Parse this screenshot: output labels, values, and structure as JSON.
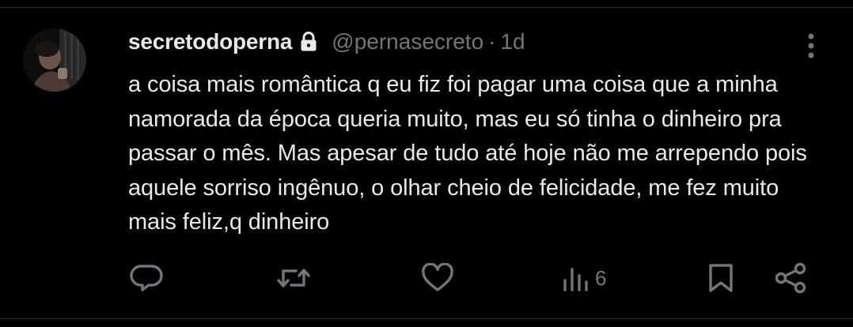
{
  "tweet": {
    "display_name": "secretodoperna",
    "handle": "@pernasecreto",
    "separator": "·",
    "time": "1d",
    "text": "a coisa mais romântica q eu fiz foi pagar uma coisa que a minha namorada da época queria muito, mas eu só tinha o dinheiro pra passar o mês. Mas apesar de tudo até hoje não me arrependo pois aquele sorriso ingênuo, o olhar cheio de felicidade, me fez muito mais feliz,q dinheiro",
    "icons": {
      "lock": "lock-icon",
      "more": "more-vertical-icon",
      "reply": "reply-icon",
      "retweet": "retweet-icon",
      "like": "heart-icon",
      "views": "views-icon",
      "bookmark": "bookmark-icon",
      "share": "share-icon"
    },
    "actions": {
      "views_count": "6"
    }
  },
  "colors": {
    "background": "#000000",
    "primary_text": "#e7e9ea",
    "secondary_text": "#71767b",
    "divider": "#2f3336"
  }
}
